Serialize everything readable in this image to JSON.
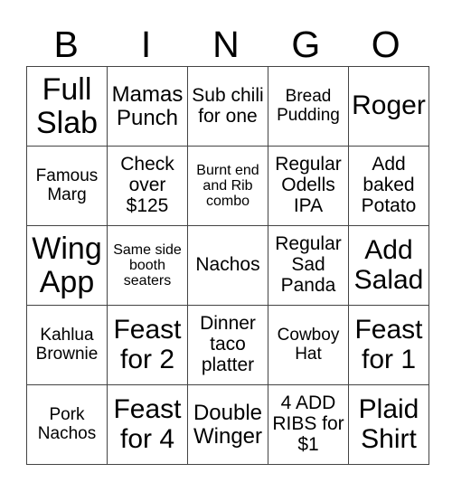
{
  "header": {
    "letters": [
      "B",
      "I",
      "N",
      "G",
      "O"
    ]
  },
  "rows": [
    [
      "Full Slab",
      "Mamas Punch",
      "Sub chili for one",
      "Bread Pudding",
      "Roger"
    ],
    [
      "Famous Marg",
      "Check over $125",
      "Burnt end and Rib combo",
      "Regular Odells IPA",
      "Add baked Potato"
    ],
    [
      "Wing App",
      "Same side booth seaters",
      "Nachos",
      "Regular Sad Panda",
      "Add Salad"
    ],
    [
      "Kahlua Brownie",
      "Feast for 2",
      "Dinner taco platter",
      "Cowboy Hat",
      "Feast for 1"
    ],
    [
      "Pork Nachos",
      "Feast for 4",
      "Double Winger",
      "4 ADD RIBS for $1",
      "Plaid Shirt"
    ]
  ]
}
